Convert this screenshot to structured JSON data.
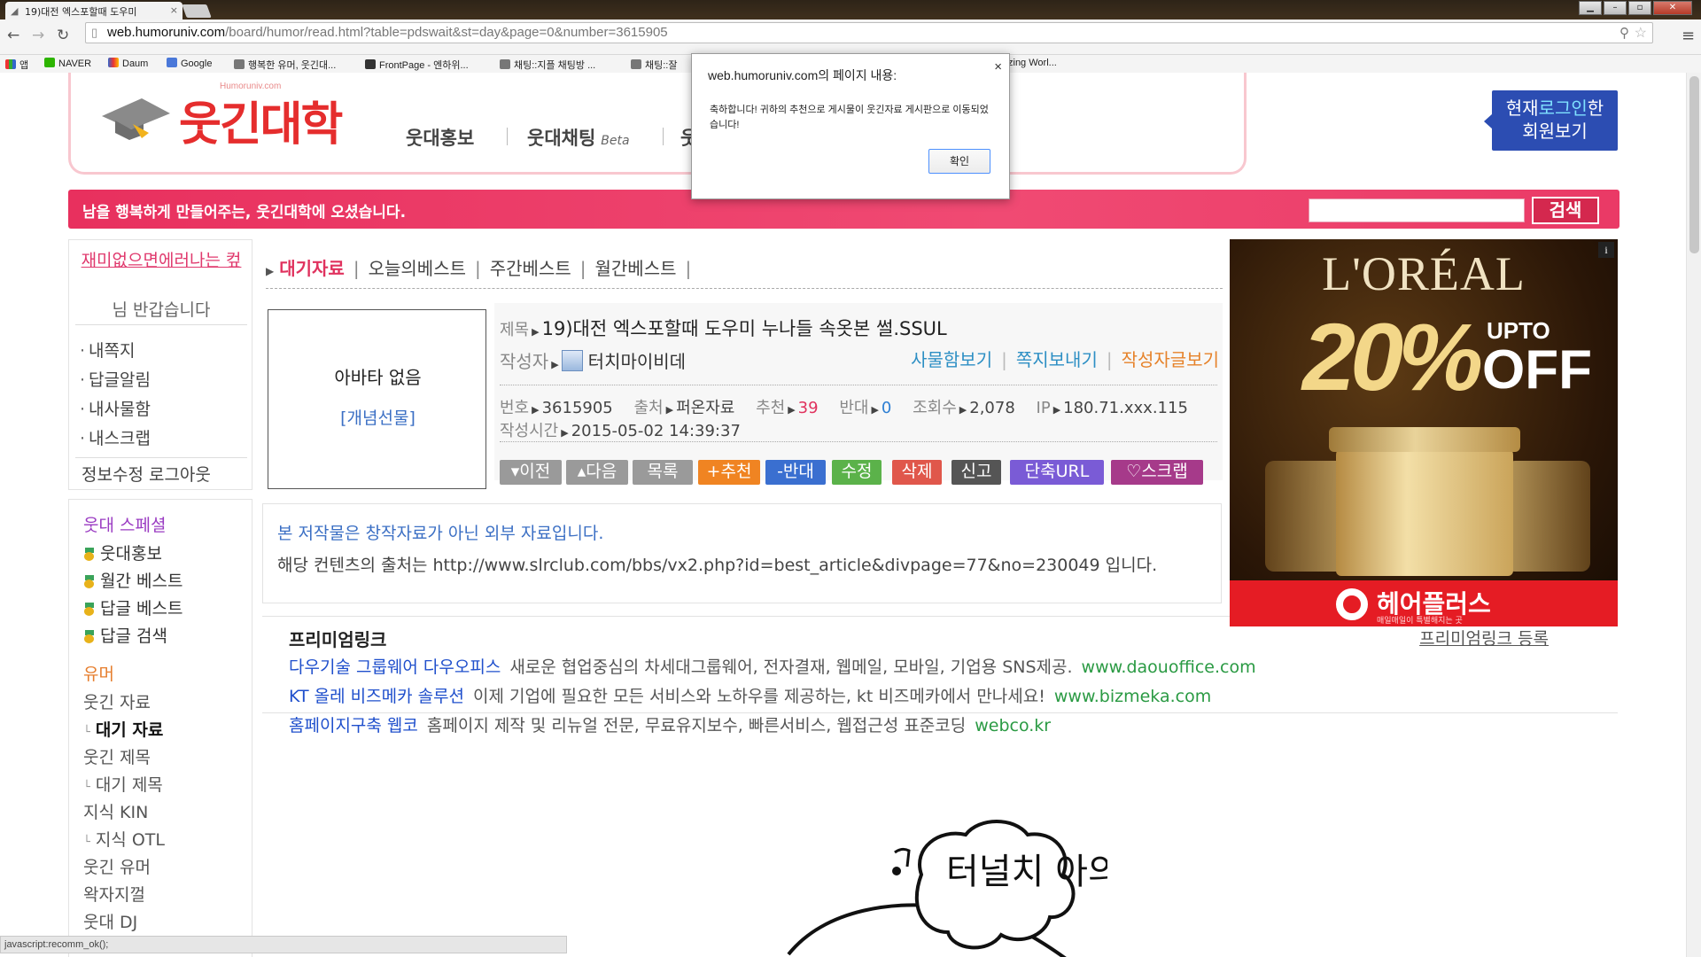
{
  "browser": {
    "tab_title": "19)대전 엑스포할때 도우미",
    "url_host": "web.humoruniv.com",
    "url_rest": "/board/humor/read.html?table=pdswait&st=day&page=0&number=3615905",
    "bookmarks": [
      "앱",
      "NAVER",
      "Daum",
      "Google",
      "행복한 유머, 웃긴대...",
      "FrontPage - 엔하위...",
      "채팅::지플 채팅방 ...",
      "채팅::잘",
      "zing Worl..."
    ],
    "status_text": "javascript:recomm_ok();"
  },
  "header": {
    "logo_text": "웃긴대학",
    "logo_sub": "Humoruniv.com",
    "nav": [
      "웃대홍보",
      "웃대채팅",
      "웃"
    ],
    "nav_beta": "Beta",
    "login_view": [
      "현재로그인한",
      "회원보기"
    ],
    "login_view_hl": "로그인",
    "banner_text": "남을 행복하게 만들어주는, 웃긴대학에 오셨습니다.",
    "search_button": "검색"
  },
  "sidebar": {
    "user_name": "재미없으면에러나는 컾",
    "welcome": "님 반갑습니다",
    "menu": [
      "내쪽지",
      "답글알림",
      "내사물함",
      "내스크랩"
    ],
    "links": "정보수정 로그아웃",
    "special_title": "웃대 스페셜",
    "special_items": [
      "웃대홍보",
      "월간 베스트",
      "답글 베스트",
      "답글 검색"
    ],
    "humor_title": "유머",
    "humor_items": [
      {
        "label": "웃긴 자료",
        "sub": false
      },
      {
        "label": "대기 자료",
        "sub": true,
        "current": true
      },
      {
        "label": "웃긴 제목",
        "sub": false
      },
      {
        "label": "대기 제목",
        "sub": true
      },
      {
        "label": "지식 KIN",
        "sub": false
      },
      {
        "label": "지식 OTL",
        "sub": true
      },
      {
        "label": "웃긴 유머",
        "sub": false
      },
      {
        "label": "왁자지껄",
        "sub": false
      },
      {
        "label": "웃대 DJ",
        "sub": false
      }
    ]
  },
  "board": {
    "tabs": [
      "대기자료",
      "오늘의베스트",
      "주간베스트",
      "월간베스트"
    ],
    "active_tab": "대기자료"
  },
  "post": {
    "avatar_none": "아바타 없음",
    "avatar_gift": "[개념선물]",
    "title_label": "제목",
    "title": "19)대전 엑스포할때 도우미 누나들 속옷본 썰.SSUL",
    "writer_label": "작성자",
    "writer": "터치마이비데",
    "writer_links": [
      "사물함보기",
      "쪽지보내기",
      "작성자글보기"
    ],
    "meta": {
      "num_label": "번호",
      "num": "3615905",
      "source_label": "출처",
      "source": "퍼온자료",
      "rec_label": "추천",
      "rec": "39",
      "opp_label": "반대",
      "opp": "0",
      "views_label": "조회수",
      "views": "2,078",
      "ip_label": "IP",
      "ip": "180.71.xxx.115"
    },
    "time_label": "작성시간",
    "time": "2015-05-02 14:39:37",
    "buttons": [
      {
        "label": "▾이전",
        "color": "#9a9a9a"
      },
      {
        "label": "▴다음",
        "color": "#9a9a9a"
      },
      {
        "label": "목록",
        "color": "#9a9a9a"
      },
      {
        "label": "+추천",
        "color": "#f08422"
      },
      {
        "label": "-반대",
        "color": "#3a6fd0"
      },
      {
        "label": "수정",
        "color": "#5bb24a"
      },
      {
        "label": "삭제",
        "color": "#e0574b"
      },
      {
        "label": "신고",
        "color": "#555555"
      },
      {
        "label": "단축URL",
        "color": "#7a5bd6"
      },
      {
        "label": "♡스크랩",
        "color": "#a63a8a"
      }
    ],
    "notice_1": "본 저작물은 창작자료가 아닌 외부 자료입니다.",
    "notice_2": "해당 컨텐츠의 출처는 http://www.slrclub.com/bbs/vx2.php?id=best_article&divpage=77&no=230049 입니다."
  },
  "premium": {
    "title": "프리미엄링크",
    "register": "프리미엄링크 등록",
    "links": [
      {
        "title": "다우기술 그룹웨어 다우오피스",
        "desc": "새로운 협업중심의 차세대그룹웨어, 전자결재, 웹메일, 모바일, 기업용 SNS제공.",
        "url": "www.daouoffice.com"
      },
      {
        "title": "KT 올레 비즈메카 솔루션",
        "desc": "이제 기업에 필요한 모든 서비스와 노하우를 제공하는, kt 비즈메카에서 만나세요!",
        "url": "www.bizmeka.com"
      },
      {
        "title": "홈페이지구축 웹코",
        "desc": "홈페이지 제작 및 리뉴얼 전문, 무료유지보수, 빠른서비스, 웹접근성 표준코딩",
        "url": "webco.kr"
      }
    ]
  },
  "ad": {
    "brand": "L'ORÉAL",
    "percent": "20%",
    "upto": "UPTO",
    "off": "OFF",
    "store": "헤어플러스",
    "slogan": "매일매일이 특별해지는 곳",
    "info": "i"
  },
  "drawing": {
    "text": "터널치 아의"
  },
  "dialog": {
    "title": "web.humoruniv.com의 페이지 내용:",
    "message": "축하합니다! 귀하의 추천으로 게시물이 웃긴자료 게시판으로 이동되었습니다!",
    "ok": "확인",
    "close": "×"
  }
}
